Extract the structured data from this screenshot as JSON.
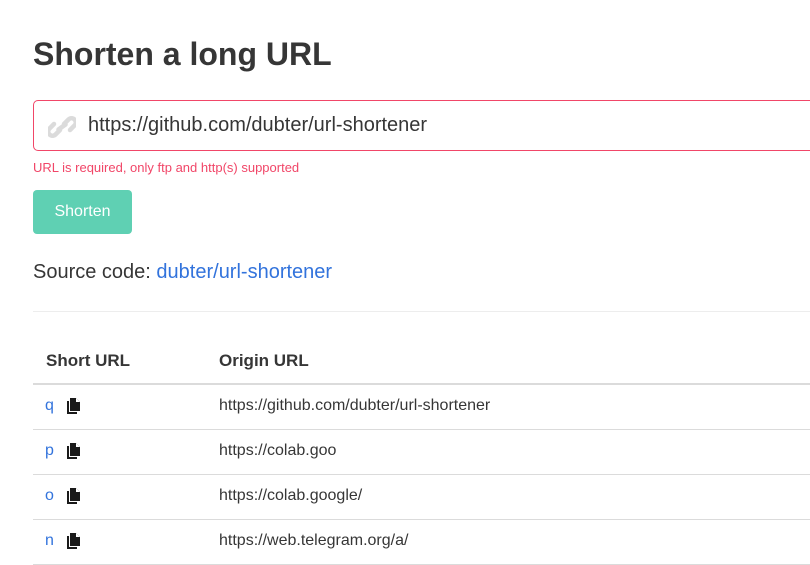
{
  "page": {
    "title": "Shorten a long URL"
  },
  "form": {
    "url_value": "https://github.com/dubter/url-shortener",
    "url_icon": "link-icon",
    "error": "URL is required, only ftp and http(s) supported",
    "submit_label": "Shorten"
  },
  "source": {
    "prefix": "Source code: ",
    "link_text": "dubter/url-shortener"
  },
  "table": {
    "headers": [
      "Short URL",
      "Origin URL"
    ],
    "copy_icon": "copy-icon",
    "rows": [
      {
        "short": "q",
        "origin": "https://github.com/dubter/url-shortener"
      },
      {
        "short": "p",
        "origin": "https://colab.goo"
      },
      {
        "short": "o",
        "origin": "https://colab.google/"
      },
      {
        "short": "n",
        "origin": "https://web.telegram.org/a/"
      }
    ]
  },
  "colors": {
    "danger": "#f14668",
    "primary": "#5fd0b3",
    "link": "#3273dc",
    "text": "#363636"
  }
}
